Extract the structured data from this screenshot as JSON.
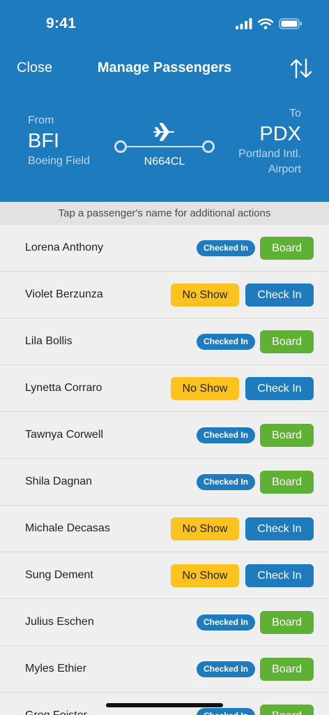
{
  "status_bar": {
    "time": "9:41",
    "icons": [
      "cellular-signal-icon",
      "wifi-icon",
      "battery-icon"
    ]
  },
  "nav": {
    "close_label": "Close",
    "title": "Manage Passengers",
    "sort_icon": "sort-arrows-icon"
  },
  "flight": {
    "from": {
      "label": "From",
      "code": "BFI",
      "name": "Boeing Field"
    },
    "to": {
      "label": "To",
      "code": "PDX",
      "name": "Portland Intl. Airport"
    },
    "tail_number": "N664CL"
  },
  "hint": "Tap a passenger's name for additional actions",
  "passengers": [
    {
      "name": "Lorena Anthony",
      "status": "checked_in",
      "badge": "Checked In",
      "action": "Board"
    },
    {
      "name": "Violet Berzunza",
      "status": "pending",
      "secondary": "No Show",
      "action": "Check In"
    },
    {
      "name": "Lila Bollis",
      "status": "checked_in",
      "badge": "Checked In",
      "action": "Board"
    },
    {
      "name": "Lynetta Corraro",
      "status": "pending",
      "secondary": "No Show",
      "action": "Check In"
    },
    {
      "name": "Tawnya Corwell",
      "status": "checked_in",
      "badge": "Checked In",
      "action": "Board"
    },
    {
      "name": "Shila Dagnan",
      "status": "checked_in",
      "badge": "Checked In",
      "action": "Board"
    },
    {
      "name": "Michale Decasas",
      "status": "pending",
      "secondary": "No Show",
      "action": "Check In"
    },
    {
      "name": "Sung Dement",
      "status": "pending",
      "secondary": "No Show",
      "action": "Check In"
    },
    {
      "name": "Julius Eschen",
      "status": "checked_in",
      "badge": "Checked In",
      "action": "Board"
    },
    {
      "name": "Myles Ethier",
      "status": "checked_in",
      "badge": "Checked In",
      "action": "Board"
    },
    {
      "name": "Greg Foister",
      "status": "checked_in",
      "badge": "Checked In",
      "action": "Board"
    }
  ],
  "colors": {
    "header": "#1d7bbe",
    "board": "#5fb135",
    "no_show": "#fcc21f",
    "check_in": "#1d7bbe",
    "badge": "#1d7bbe"
  }
}
